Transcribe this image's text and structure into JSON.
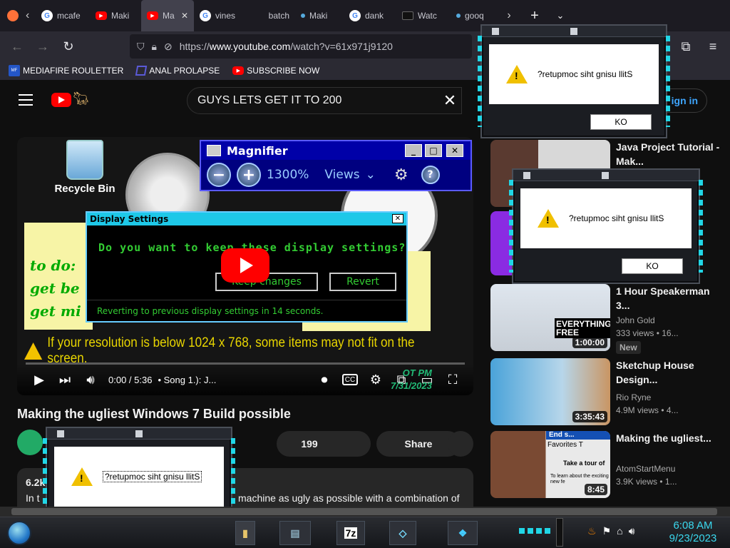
{
  "browser": {
    "tabs": [
      {
        "label": "mcafe",
        "icon": "google-icon"
      },
      {
        "label": "Maki",
        "icon": "youtube-icon"
      },
      {
        "label": "Ma",
        "icon": "youtube-icon",
        "active": true
      },
      {
        "label": "vines",
        "icon": "google-icon"
      },
      {
        "label": "batch",
        "icon": ""
      },
      {
        "label": "Maki",
        "icon": "dot-icon"
      },
      {
        "label": "dank",
        "icon": "google-icon"
      },
      {
        "label": "Watc",
        "icon": "video-icon"
      },
      {
        "label": "gooq",
        "icon": "dot-icon"
      }
    ],
    "url": {
      "prefix": "https://",
      "host": "www.youtube.com",
      "path": "/watch?v=61x971j9120"
    },
    "bookmarks": [
      {
        "label": "MEDIAFIRE ROULETTER"
      },
      {
        "label": "ANAL PROLAPSE"
      },
      {
        "label": "SUBSCRIBE NOW"
      }
    ]
  },
  "youtube": {
    "search_value": "GUYS LETS GET IT TO 200",
    "signin_label": "ign in",
    "video": {
      "title": "Making the ugliest Windows 7 Build possible",
      "time": "0:00 / 5:36",
      "chapter": "• Song 1.): J...",
      "desktop_label": "Recycle Bin",
      "notes_lines": [
        "to do:",
        "get be",
        "get mi"
      ],
      "warning": "If your resolution is below 1024 x 768, some items may not fit on the screen.",
      "date_overlay_time": "OT PM",
      "date_overlay_date": "7/31/2023",
      "magnifier": {
        "title": "Magnifier",
        "zoom": "1300%",
        "views_label": "Views"
      },
      "display_dialog": {
        "title": "Display Settings",
        "question": "Do you want to keep these display settings?",
        "keep_label": "Keep changes",
        "revert_label": "Revert",
        "footer": "Reverting to previous display settings in 14 seconds."
      }
    },
    "likes": "199",
    "share_label": "Share",
    "description_count": "6.2k",
    "description_start": "In t",
    "description_text": "machine as ugly as possible with a combination of",
    "recommendations": [
      {
        "title": "Java Project Tutorial - Mak...",
        "channel": "",
        "meta": "",
        "duration": ""
      },
      {
        "title": "1 Hour Speakerman 3...",
        "channel": "John Gold",
        "meta": "333 views • 16...",
        "duration": "1:00:00",
        "badge": "New",
        "thumb_text": "EVERYTHING FREE"
      },
      {
        "title": "Sketchup House Design...",
        "channel": "Rio Ryne",
        "meta": "4.9M views • 4...",
        "duration": "3:35:43"
      },
      {
        "title": "Making the ugliest...",
        "channel": "AtomStartMenu",
        "meta": "3.9K views • 1...",
        "duration": "8:45",
        "thumb_text": "Favorites T",
        "thumb_text2": "Take a tour of",
        "thumb_text3": "To learn about the exciting new fe",
        "thumb_text4": "End s..."
      }
    ]
  },
  "alerts": [
    {
      "message": "?retupmoc siht gnisu llitS",
      "ok_label": "KO"
    },
    {
      "message": "?retupmoc siht gnisu llitS",
      "ok_label": "KO"
    },
    {
      "message": "?retupmoc siht gnisu llitS",
      "ok_label": "KO"
    }
  ],
  "taskbar": {
    "items": [
      "7z"
    ],
    "clock_time": "6:08 AM",
    "clock_date": "9/23/2023"
  },
  "colors": {
    "youtube_red": "#ff0000",
    "accent_cyan": "#21d6e6",
    "link_blue": "#3ea6ff"
  }
}
